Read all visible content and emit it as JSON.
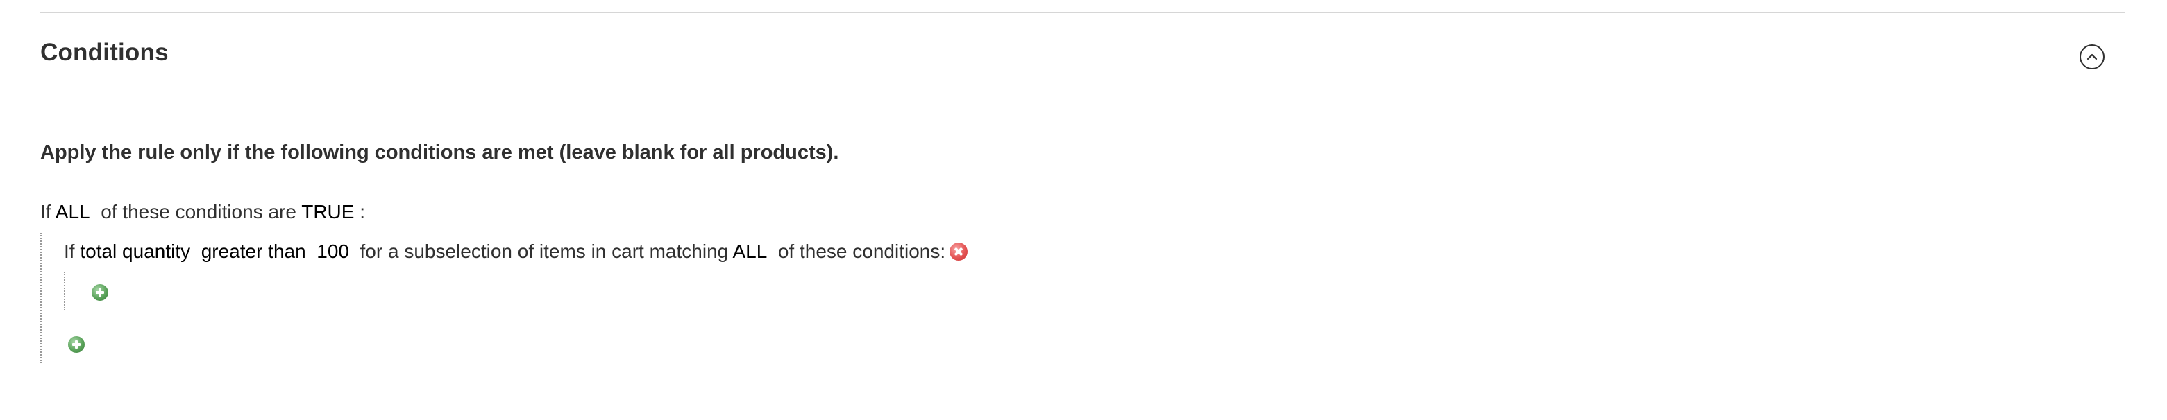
{
  "section": {
    "title": "Conditions",
    "collapse_icon": "chevron-up-icon"
  },
  "apply_label": "Apply the rule only if the following conditions are met (leave blank for all products).",
  "root_condition": {
    "prefix": "If",
    "aggregator": "ALL",
    "middle": "of these conditions are",
    "value": "TRUE",
    "suffix": ":"
  },
  "sub_condition": {
    "prefix": "If",
    "attribute": "total quantity",
    "operator": "greater than",
    "value": "100",
    "middle": "for a subselection of items in cart matching",
    "aggregator": "ALL",
    "suffix": "of these conditions:",
    "remove_icon": "remove-icon"
  },
  "add_icons": {
    "sub": "add-condition-icon",
    "root": "add-condition-icon"
  },
  "colors": {
    "text": "#303030",
    "divider": "#d6d6d6",
    "remove": "#e45454",
    "add": "#5ba35b"
  }
}
